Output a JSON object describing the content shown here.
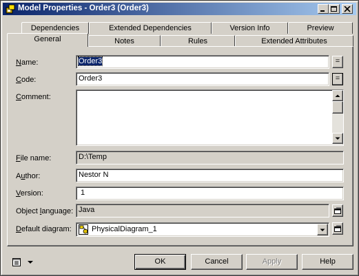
{
  "window": {
    "title": "Model Properties - Order3 (Order3)",
    "controls": [
      "minimize-icon",
      "maximize-icon",
      "close-icon"
    ]
  },
  "tabs": {
    "row_back": [
      "Dependencies",
      "Extended Dependencies",
      "Version Info",
      "Preview"
    ],
    "row_front": [
      "General",
      "Notes",
      "Rules",
      "Extended Attributes"
    ],
    "active": "General"
  },
  "form": {
    "name": {
      "label_u": "N",
      "label_rest": "ame:",
      "value": "Order3"
    },
    "code": {
      "label_u": "C",
      "label_rest": "ode:",
      "value": "Order3"
    },
    "comment": {
      "label_u": "C",
      "label_rest": "omment:",
      "value": ""
    },
    "file_name": {
      "label_u": "F",
      "label_rest": "ile name:",
      "value": "D:\\Temp"
    },
    "author": {
      "label_pre": "A",
      "label_u": "u",
      "label_rest": "thor:",
      "value": "Nestor N"
    },
    "version": {
      "label_u": "V",
      "label_rest": "ersion:",
      "value": "1"
    },
    "object_language": {
      "label_pre": "Object ",
      "label_u": "l",
      "label_rest": "anguage:",
      "value": "Java"
    },
    "default_diagram": {
      "label_u": "D",
      "label_rest": "efault diagram:",
      "value": "PhysicalDiagram_1"
    },
    "equals_label": "="
  },
  "buttons": {
    "ok": "OK",
    "cancel": "Cancel",
    "apply": "Apply",
    "help": "Help"
  },
  "colors": {
    "title_active_start": "#0a246a",
    "title_active_end": "#a6caf0",
    "face": "#d4d0c8",
    "selection": "#0a246a"
  }
}
